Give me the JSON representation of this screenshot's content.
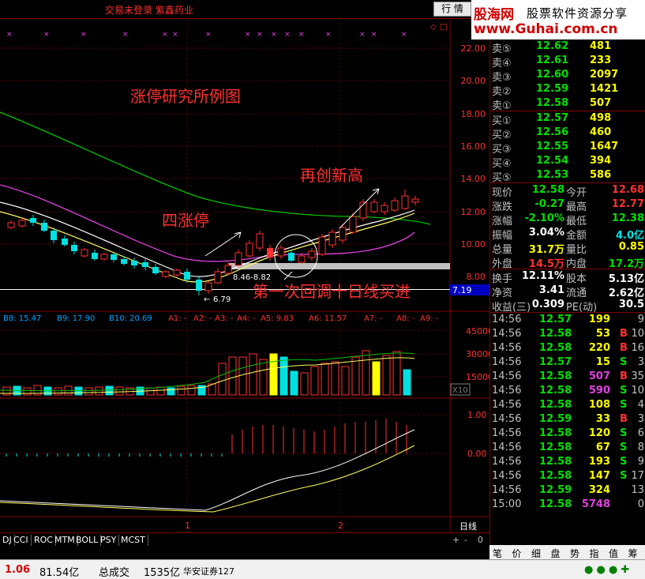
{
  "topbar": {
    "title": "交易未登录  紫鑫药业",
    "hq_button": "行 情"
  },
  "logo": {
    "line1_brand": "股海网",
    "line1_slogan": "股票软件资源分享",
    "line2": "www.Guhai.com.cn"
  },
  "annotations": {
    "title": "涨停研究所例图",
    "limit_up": "四涨停",
    "new_high": "再创新高",
    "pullback": "第一次回调十日线买进",
    "range": "8.46-8.82",
    "low": "6.79",
    "current_tag": "7.19"
  },
  "price_axis": [
    "22.00",
    "20.00",
    "18.00",
    "16.00",
    "14.00",
    "12.00",
    "10.00",
    "8.00"
  ],
  "ma_legend": [
    {
      "label": "B8: 15.47",
      "color": "#00a0ff"
    },
    {
      "label": "B9: 17.90",
      "color": "#00a0ff"
    },
    {
      "label": "B10: 20.69",
      "color": "#00a0ff"
    },
    {
      "label": "A1: -",
      "color": "#ff3030"
    },
    {
      "label": "A2: -",
      "color": "#ff3030"
    },
    {
      "label": "A3: -",
      "color": "#ff3030"
    },
    {
      "label": "A4: -",
      "color": "#ff3030"
    },
    {
      "label": "A5: 9.83",
      "color": "#ff3030"
    },
    {
      "label": "A6: 11.57",
      "color": "#ff3030"
    },
    {
      "label": "A7: -",
      "color": "#ff3030"
    },
    {
      "label": "A8: -",
      "color": "#ff3030"
    },
    {
      "label": "A9: -",
      "color": "#ff3030"
    }
  ],
  "vol_axis": [
    "45000",
    "30000",
    "15000",
    "X10"
  ],
  "macd_axis": [
    "1.00",
    "0.00"
  ],
  "x_labels": [
    "1",
    "2"
  ],
  "period_label": "日线",
  "scroll_buttons": [
    "+",
    "-",
    "0"
  ],
  "order_book": {
    "sell": [
      {
        "label": "卖⑤",
        "price": "12.62",
        "vol": "481"
      },
      {
        "label": "卖④",
        "price": "12.61",
        "vol": "233"
      },
      {
        "label": "卖③",
        "price": "12.60",
        "vol": "2097"
      },
      {
        "label": "卖②",
        "price": "12.59",
        "vol": "1421"
      },
      {
        "label": "卖①",
        "price": "12.58",
        "vol": "507"
      }
    ],
    "buy": [
      {
        "label": "买①",
        "price": "12.57",
        "vol": "498"
      },
      {
        "label": "买②",
        "price": "12.56",
        "vol": "460"
      },
      {
        "label": "买③",
        "price": "12.55",
        "vol": "1647"
      },
      {
        "label": "买④",
        "price": "12.54",
        "vol": "394"
      },
      {
        "label": "买⑤",
        "price": "12.53",
        "vol": "586"
      }
    ]
  },
  "quote": [
    [
      {
        "k": "现价",
        "v": "12.58",
        "c": "g"
      },
      {
        "k": "今开",
        "v": "12.68",
        "c": "r"
      }
    ],
    [
      {
        "k": "涨跌",
        "v": "-0.27",
        "c": "g"
      },
      {
        "k": "最高",
        "v": "12.77",
        "c": "r"
      }
    ],
    [
      {
        "k": "涨幅",
        "v": "-2.10%",
        "c": "g"
      },
      {
        "k": "最低",
        "v": "12.38",
        "c": "g"
      }
    ],
    [
      {
        "k": "振幅",
        "v": "3.04%",
        "c": "d"
      },
      {
        "k": "金额",
        "v": "4.0亿",
        "c": "c"
      }
    ],
    [
      {
        "k": "总量",
        "v": "31.7万",
        "c": "y"
      },
      {
        "k": "量比",
        "v": "0.85",
        "c": "y"
      }
    ],
    [
      {
        "k": "外盘",
        "v": "14.5万",
        "c": "r"
      },
      {
        "k": "内盘",
        "v": "17.2万",
        "c": "g"
      }
    ],
    [
      {
        "k": "换手",
        "v": "12.11%",
        "c": "d"
      },
      {
        "k": "股本",
        "v": "5.13亿",
        "c": "d"
      }
    ],
    [
      {
        "k": "净资",
        "v": "3.41",
        "c": "d"
      },
      {
        "k": "流通",
        "v": "2.62亿",
        "c": "d"
      }
    ],
    [
      {
        "k": "收益(三)",
        "v": "0.309",
        "c": "d"
      },
      {
        "k": "PE(动)",
        "v": "30.5",
        "c": "d"
      }
    ]
  ],
  "ticks": [
    {
      "t": "14:56",
      "p": "12.57",
      "v": "199",
      "bs": "",
      "n": "9"
    },
    {
      "t": "14:56",
      "p": "12.58",
      "v": "53",
      "bs": "B",
      "n": "10"
    },
    {
      "t": "14:56",
      "p": "12.58",
      "v": "220",
      "bs": "B",
      "n": "16"
    },
    {
      "t": "14:56",
      "p": "12.57",
      "v": "15",
      "bs": "S",
      "n": "3"
    },
    {
      "t": "14:56",
      "p": "12.58",
      "v": "507",
      "bs": "B",
      "n": "35"
    },
    {
      "t": "14:56",
      "p": "12.58",
      "v": "590",
      "bs": "S",
      "n": "10"
    },
    {
      "t": "14:56",
      "p": "12.58",
      "v": "108",
      "bs": "S",
      "n": "4"
    },
    {
      "t": "14:56",
      "p": "12.59",
      "v": "33",
      "bs": "B",
      "n": "3"
    },
    {
      "t": "14:56",
      "p": "12.58",
      "v": "120",
      "bs": "S",
      "n": "6"
    },
    {
      "t": "14:56",
      "p": "12.58",
      "v": "67",
      "bs": "S",
      "n": "8"
    },
    {
      "t": "14:56",
      "p": "12.58",
      "v": "193",
      "bs": "S",
      "n": "9"
    },
    {
      "t": "14:56",
      "p": "12.58",
      "v": "147",
      "bs": "S",
      "n": "17"
    },
    {
      "t": "14:56",
      "p": "12.59",
      "v": "324",
      "bs": "",
      "n": "13"
    },
    {
      "t": "15:00",
      "p": "12.58",
      "v": "5748",
      "bs": "",
      "n": "0"
    }
  ],
  "indicator_tabs": [
    "DJ",
    "CCI",
    "ROC",
    "MTM",
    "BOLL",
    "PSY",
    "MCST"
  ],
  "right_tabs": [
    "笔",
    "价",
    "细",
    "盘",
    "势",
    "指",
    "值",
    "筹"
  ],
  "statusbar": {
    "change": "1.06",
    "amount": "81.54亿",
    "total_label": "总成交",
    "total_value": "1535亿",
    "broker": "华安证券127"
  }
}
